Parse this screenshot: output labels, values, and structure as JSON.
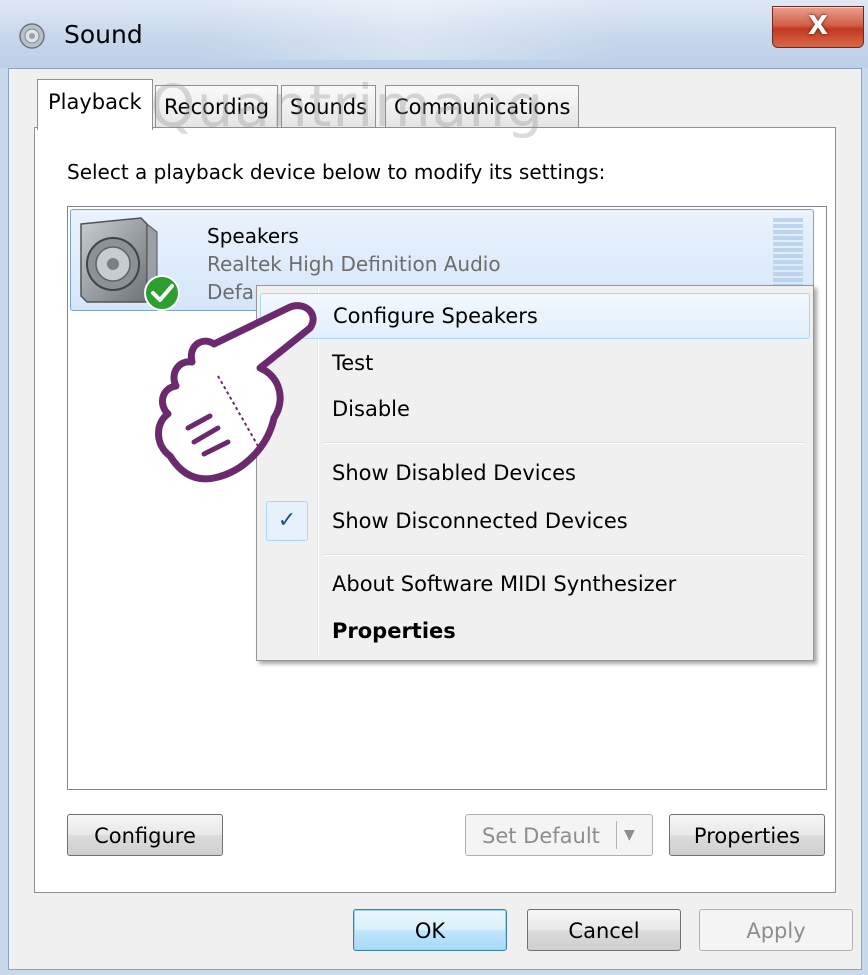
{
  "window": {
    "title": "Sound",
    "close_glyph": "X",
    "icon": "speaker-icon"
  },
  "tabs": [
    {
      "label": "Playback",
      "active": true
    },
    {
      "label": "Recording",
      "active": false
    },
    {
      "label": "Sounds",
      "active": false
    },
    {
      "label": "Communications",
      "active": false
    }
  ],
  "playback": {
    "instruction": "Select a playback device below to modify its settings:",
    "devices": [
      {
        "name": "Speakers",
        "driver": "Realtek High Definition Audio",
        "status": "Defa",
        "is_default": true,
        "icon": "speaker-icon",
        "badge": "green-check-icon"
      }
    ],
    "buttons": {
      "configure": "Configure",
      "set_default": "Set Default",
      "set_default_arrow": "▼",
      "properties": "Properties"
    }
  },
  "context_menu": {
    "items": [
      {
        "label": "Configure Speakers",
        "highlighted": true,
        "checked": false,
        "bold": false
      },
      {
        "label": "Test",
        "highlighted": false,
        "checked": false,
        "bold": false
      },
      {
        "label": "Disable",
        "highlighted": false,
        "checked": false,
        "bold": false
      },
      {
        "label": "Show Disabled Devices",
        "highlighted": false,
        "checked": false,
        "bold": false
      },
      {
        "label": "Show Disconnected Devices",
        "highlighted": false,
        "checked": true,
        "bold": false
      },
      {
        "label": "About Software MIDI Synthesizer",
        "highlighted": false,
        "checked": false,
        "bold": false
      },
      {
        "label": "Properties",
        "highlighted": false,
        "checked": false,
        "bold": true
      }
    ],
    "check_glyph": "✓"
  },
  "dialog_buttons": {
    "ok": "OK",
    "cancel": "Cancel",
    "apply": "Apply"
  },
  "watermark": "Quantrimang",
  "colors": {
    "selection": "#d5e6fa",
    "selection_border": "#7da2ce",
    "close_button": "#c0391f",
    "pointer_outline": "#6b2a6e",
    "default_badge": "#2e9e2e"
  }
}
